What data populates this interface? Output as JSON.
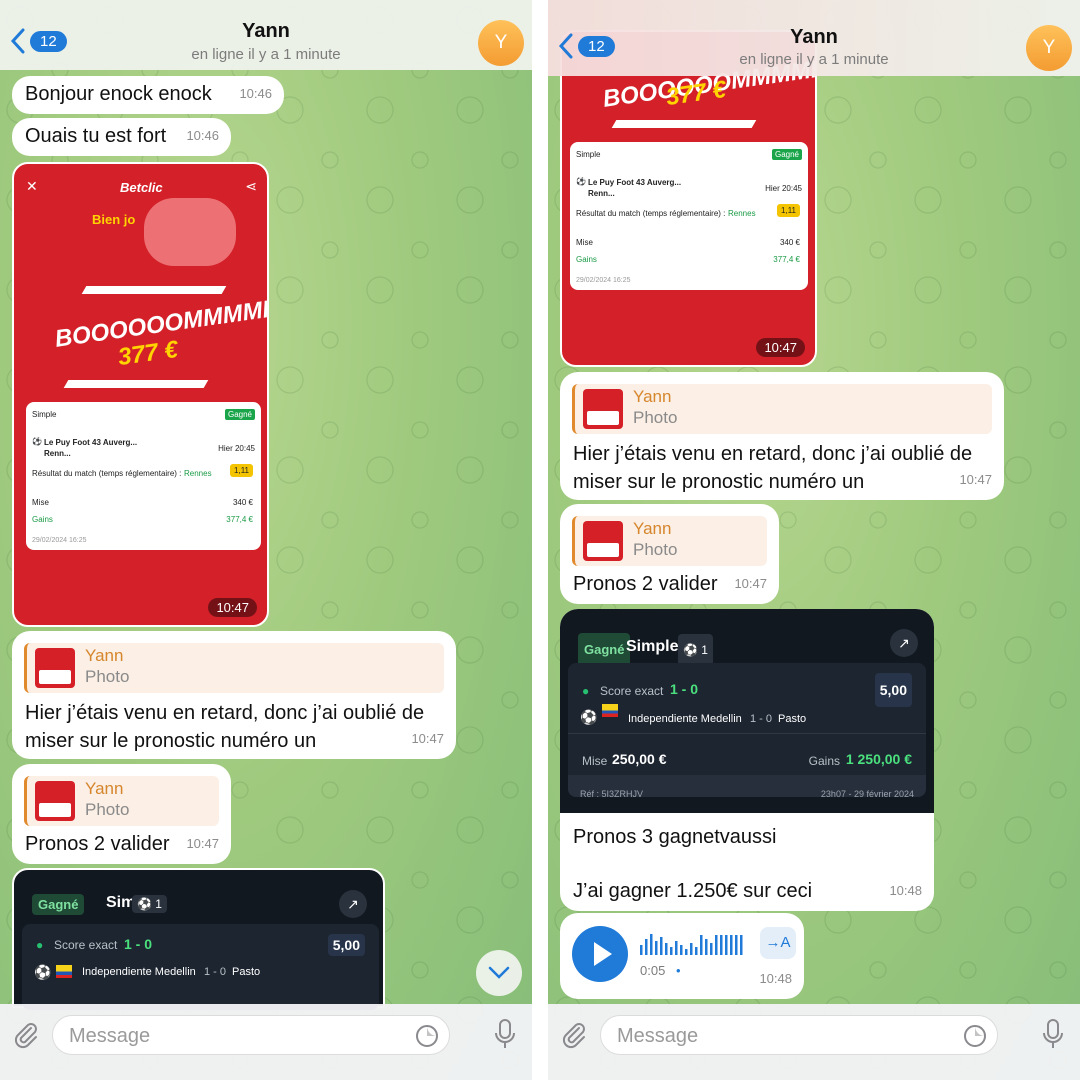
{
  "header": {
    "back_count": "12",
    "contact_name": "Yann",
    "status": "en ligne il y a 1 minute",
    "avatar_letter": "Y"
  },
  "messages": {
    "greeting": {
      "text": "Bonjour enock  enock",
      "time": "10:46"
    },
    "fort": {
      "text": "Ouais tu est fort",
      "time": "10:46"
    },
    "betclic_photo": {
      "brand": "Betclic",
      "greeting": "Bien jo",
      "headline": "BOOOOOOMMMMM",
      "amount": "377 €",
      "time": "10:47",
      "card": {
        "type": "Simple",
        "status": "Gagné",
        "match": "Le Puy Foot 43 Auverg... Renn...",
        "date": "Hier 20:45",
        "market": "Résultat du match (temps réglementaire) :",
        "pick": "Rennes",
        "odds": "1,11",
        "stake_label": "Mise",
        "stake": "340 €",
        "gains_label": "Gains",
        "gains": "377,4 €",
        "placed": "29/02/2024 16:25"
      }
    },
    "retard": {
      "reply_name": "Yann",
      "reply_type": "Photo",
      "text": "Hier j’étais venu en retard, donc j’ai oublié de miser sur le pronostic numéro un",
      "time": "10:47"
    },
    "pronos2": {
      "reply_name": "Yann",
      "reply_type": "Photo",
      "text": "Pronos 2 valider",
      "time": "10:47"
    },
    "dark_bet": {
      "status": "Gagné",
      "type": "Simple",
      "count": "1",
      "score_label": "Score exact",
      "score": "1 - 0",
      "odds": "5,00",
      "home": "Independiente Medellin",
      "result": "1 - 0",
      "away": "Pasto",
      "stake_label": "Mise",
      "stake": "250,00 €",
      "gains_label": "Gains",
      "gains": "1 250,00 €",
      "ref": "Réf : 5I3ZRHJV",
      "placed": "23h07 - 29 février 2024"
    },
    "pronos3": {
      "line1": "Pronos 3 gagnetvaussi",
      "line2": "J’ai gagner 1.250€ sur ceci",
      "time": "10:48"
    },
    "voice": {
      "duration": "0:05",
      "time": "10:48",
      "transcribe": "→A"
    }
  },
  "composer": {
    "placeholder": "Message"
  },
  "colors": {
    "accent": "#1f7ad8",
    "reply_name": "#d6862c",
    "betclic_red": "#d32029",
    "win_green": "#1aa54a"
  }
}
